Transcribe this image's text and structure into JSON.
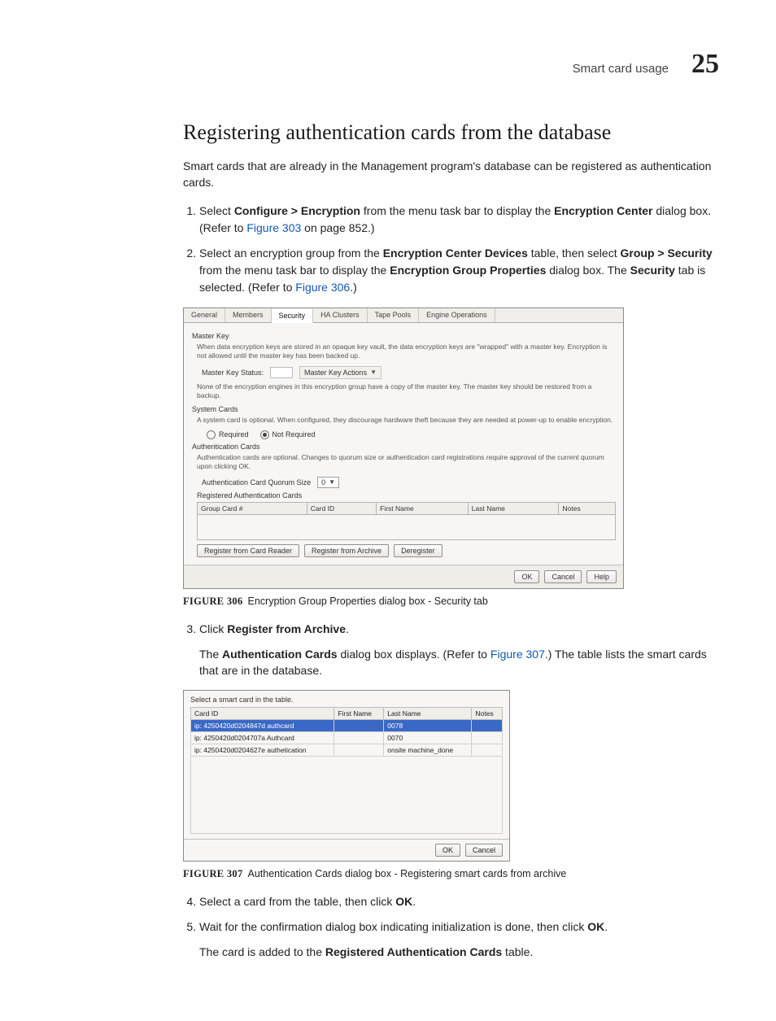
{
  "header": {
    "section": "Smart card usage",
    "chapter_number": "25"
  },
  "title": "Registering authentication cards from the database",
  "intro": "Smart cards that are already in the Management program's database can be registered as authentication cards.",
  "steps": {
    "s1_a": "Select ",
    "s1_b": "Configure > Encryption",
    "s1_c": " from the menu task bar to display the ",
    "s1_d": "Encryption Center",
    "s1_e": " dialog box. (Refer to ",
    "s1_link": "Figure 303",
    "s1_f": " on page 852.)",
    "s2_a": "Select an encryption group from the ",
    "s2_b": "Encryption Center Devices",
    "s2_c": " table, then select ",
    "s2_d": "Group > Security",
    "s2_e": " from the menu task bar to display the ",
    "s2_f": "Encryption Group Properties",
    "s2_g": " dialog box. The ",
    "s2_h": "Security",
    "s2_i": " tab is selected. (Refer to ",
    "s2_link": "Figure 306",
    "s2_j": ".)",
    "s3_a": "Click ",
    "s3_b": "Register from Archive",
    "s3_c": ".",
    "s3_p_a": "The ",
    "s3_p_b": "Authentication Cards",
    "s3_p_c": " dialog box displays. (Refer to ",
    "s3_p_link": "Figure 307",
    "s3_p_d": ".) The table lists the smart cards that are in the database.",
    "s4_a": "Select a card from the table, then click ",
    "s4_b": "OK",
    "s4_c": ".",
    "s5_a": "Wait for the confirmation dialog box indicating initialization is done, then click ",
    "s5_b": "OK",
    "s5_c": ".",
    "s5_p_a": "The card is added to the ",
    "s5_p_b": "Registered Authentication Cards",
    "s5_p_c": " table."
  },
  "fig306": {
    "label": "FIGURE 306",
    "caption": "Encryption Group Properties dialog box - Security tab",
    "tabs": [
      "General",
      "Members",
      "Security",
      "HA Clusters",
      "Tape Pools",
      "Engine Operations"
    ],
    "active_tab_idx": 2,
    "master_key_head": "Master Key",
    "master_key_desc": "When data encryption keys are stored in an opaque key vault, the data encryption keys are \"wrapped\" with a master key. Encryption is not allowed until the master key has been backed up.",
    "mk_status_label": "Master Key Status:",
    "mk_actions_label": "Master Key Actions",
    "mk_note": "None of the encryption engines in this encryption group have a copy of the master key. The master key should be restored from a backup.",
    "system_cards_head": "System Cards",
    "system_cards_desc": "A system card is optional. When configured, they discourage hardware theft because they are needed at power-up to enable encryption.",
    "radio_required": "Required",
    "radio_not_required": "Not Required",
    "auth_cards_head": "Authentication Cards",
    "auth_cards_desc": "Authentication cards are optional. Changes to quorum size or authentication card registrations require approval of the current quorum upon clicking OK.",
    "quorum_label": "Authentication Card Quorum Size",
    "quorum_value": "0",
    "reg_cards_head": "Registered Authentication Cards",
    "cols": [
      "Group Card #",
      "Card ID",
      "First Name",
      "Last Name",
      "Notes"
    ],
    "btn_reg_reader": "Register from Card Reader",
    "btn_reg_archive": "Register from Archive",
    "btn_dereg": "Deregister",
    "btn_ok": "OK",
    "btn_cancel": "Cancel",
    "btn_help": "Help"
  },
  "fig307": {
    "label": "FIGURE 307",
    "caption": "Authentication Cards dialog box - Registering smart cards from archive",
    "prompt": "Select a smart card in the table.",
    "cols": [
      "Card ID",
      "First Name",
      "Last Name",
      "Notes"
    ],
    "rows": [
      {
        "id": "ip: 4250420d0204847d authcard",
        "first": "",
        "last": "0078",
        "notes": ""
      },
      {
        "id": "ip: 4250420d0204707a Authcard",
        "first": "",
        "last": "0070",
        "notes": ""
      },
      {
        "id": "ip: 4250420d0204627e authetication",
        "first": "",
        "last": "onsite machine_done",
        "notes": ""
      }
    ],
    "selected_row": 0,
    "btn_ok": "OK",
    "btn_cancel": "Cancel"
  }
}
